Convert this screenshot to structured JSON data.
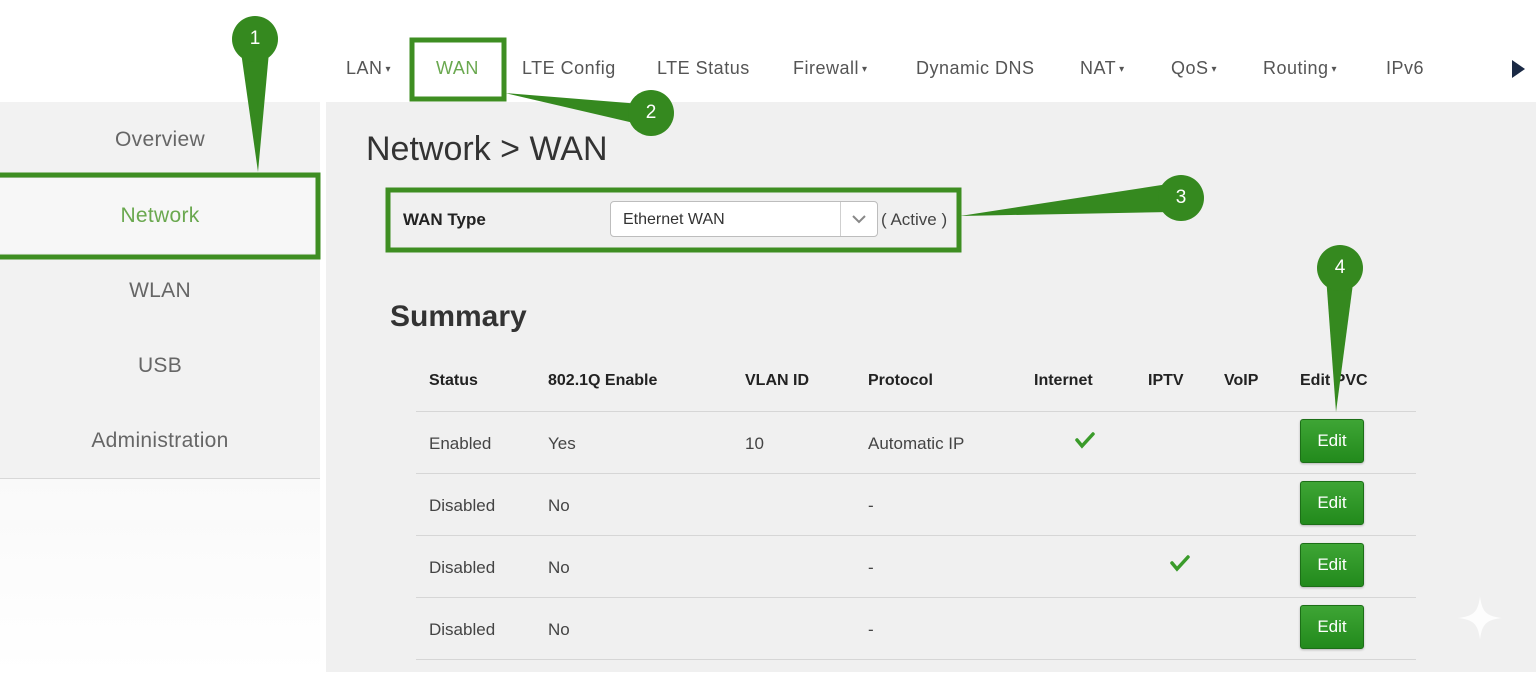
{
  "topnav": {
    "items": [
      {
        "label": "LAN",
        "caret": true
      },
      {
        "label": "WAN",
        "caret": false,
        "active": true
      },
      {
        "label": "LTE Config",
        "caret": false
      },
      {
        "label": "LTE Status",
        "caret": false
      },
      {
        "label": "Firewall",
        "caret": true
      },
      {
        "label": "Dynamic DNS",
        "caret": false
      },
      {
        "label": "NAT",
        "caret": true
      },
      {
        "label": "QoS",
        "caret": true
      },
      {
        "label": "Routing",
        "caret": true
      },
      {
        "label": "IPv6",
        "caret": false
      }
    ],
    "caret_glyph": "▾",
    "more_icon": "triangle-right-icon"
  },
  "sidebar": {
    "items": [
      {
        "label": "Overview"
      },
      {
        "label": "Network",
        "active": true
      },
      {
        "label": "WLAN"
      },
      {
        "label": "USB"
      },
      {
        "label": "Administration"
      }
    ]
  },
  "main": {
    "title": "Network > WAN",
    "wan_type": {
      "label": "WAN Type",
      "selected": "Ethernet WAN",
      "status": "( Active )"
    },
    "summary": {
      "title": "Summary",
      "columns": [
        "Status",
        "802.1Q Enable",
        "VLAN ID",
        "Protocol",
        "Internet",
        "IPTV",
        "VoIP",
        "Edit PVC"
      ],
      "rows": [
        {
          "status": "Enabled",
          "enable_8021q": "Yes",
          "vlan_id": "10",
          "protocol": "Automatic IP",
          "internet": true,
          "iptv": false,
          "voip": false,
          "edit": "Edit"
        },
        {
          "status": "Disabled",
          "enable_8021q": "No",
          "vlan_id": "",
          "protocol": "-",
          "internet": false,
          "iptv": false,
          "voip": false,
          "edit": "Edit"
        },
        {
          "status": "Disabled",
          "enable_8021q": "No",
          "vlan_id": "",
          "protocol": "-",
          "internet": false,
          "iptv": true,
          "voip": false,
          "edit": "Edit"
        },
        {
          "status": "Disabled",
          "enable_8021q": "No",
          "vlan_id": "",
          "protocol": "-",
          "internet": false,
          "iptv": false,
          "voip": false,
          "edit": "Edit"
        }
      ]
    }
  },
  "annotations": {
    "callouts": [
      "1",
      "2",
      "3",
      "4"
    ],
    "color": "#35891f",
    "highlight_color": "#3e8e22"
  },
  "colors": {
    "accent": "#6aa84f",
    "button_green": "#2e9a27",
    "check_green": "#3a9b2a"
  }
}
